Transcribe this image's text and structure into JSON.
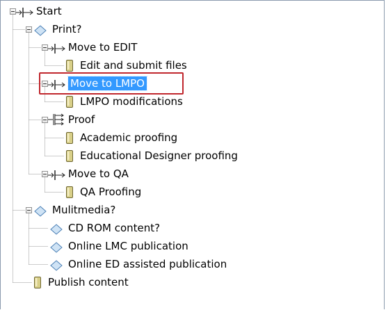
{
  "tree": {
    "nodes": [
      {
        "id": "start",
        "label": "Start",
        "type": "step",
        "depth": 0,
        "expander": "expanded"
      },
      {
        "id": "print",
        "label": "Print?",
        "type": "decision",
        "depth": 1,
        "expander": "expanded"
      },
      {
        "id": "move-edit",
        "label": "Move to EDIT",
        "type": "step",
        "depth": 2,
        "expander": "expanded"
      },
      {
        "id": "edit-submit",
        "label": "Edit and submit files",
        "type": "task",
        "depth": 3,
        "expander": "none"
      },
      {
        "id": "move-lmpo",
        "label": "Move to LMPO",
        "type": "step",
        "depth": 2,
        "expander": "expanded",
        "selected": true
      },
      {
        "id": "lmpo-mod",
        "label": "LMPO modifications",
        "type": "task",
        "depth": 3,
        "expander": "none"
      },
      {
        "id": "proof",
        "label": "Proof",
        "type": "parallel",
        "depth": 2,
        "expander": "expanded"
      },
      {
        "id": "academic",
        "label": "Academic proofing",
        "type": "task",
        "depth": 3,
        "expander": "none"
      },
      {
        "id": "edu-designer",
        "label": "Educational Designer proofing",
        "type": "task",
        "depth": 3,
        "expander": "none"
      },
      {
        "id": "move-qa",
        "label": "Move to QA",
        "type": "step",
        "depth": 2,
        "expander": "expanded"
      },
      {
        "id": "qa-proof",
        "label": "QA Proofing",
        "type": "task",
        "depth": 3,
        "expander": "none"
      },
      {
        "id": "multimedia",
        "label": "Mulitmedia?",
        "type": "decision",
        "depth": 1,
        "expander": "expanded"
      },
      {
        "id": "cdrom",
        "label": "CD ROM content?",
        "type": "decision",
        "depth": 2,
        "expander": "none"
      },
      {
        "id": "online-lmc",
        "label": "Online LMC publication",
        "type": "decision",
        "depth": 2,
        "expander": "none"
      },
      {
        "id": "online-ed",
        "label": "Online ED assisted publication",
        "type": "decision",
        "depth": 2,
        "expander": "none"
      },
      {
        "id": "publish",
        "label": "Publish content",
        "type": "task",
        "depth": 1,
        "expander": "none"
      }
    ]
  },
  "colors": {
    "selection_bg": "#3399ff",
    "selection_outline": "#c0272d",
    "decision_fill": "#cfe3f5",
    "decision_stroke": "#4a7fb5",
    "task_fill": "#d8cf88",
    "step_stroke": "#222222"
  }
}
